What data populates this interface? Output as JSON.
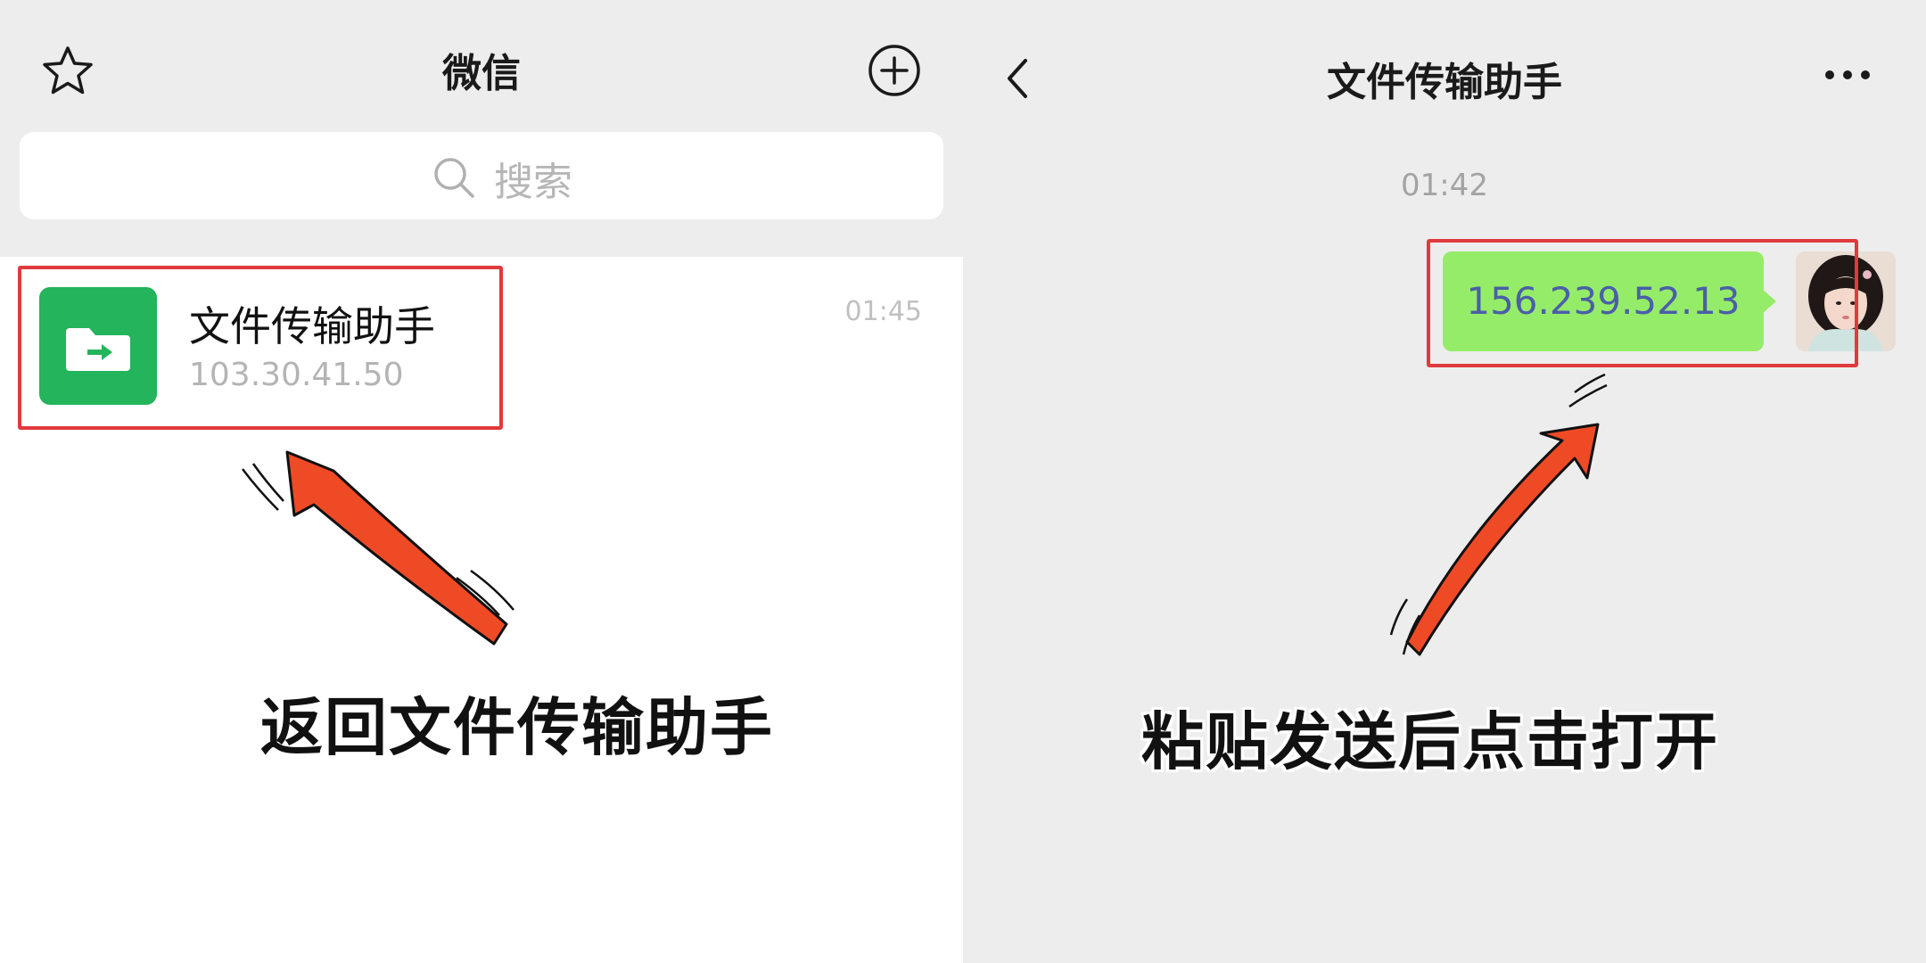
{
  "left": {
    "title": "微信",
    "search_placeholder": "搜索",
    "chat": {
      "name": "文件传输助手",
      "preview": "103.30.41.50",
      "time": "01:45"
    },
    "caption": "返回文件传输助手"
  },
  "right": {
    "title": "文件传输助手",
    "time_label": "01:42",
    "message": "156.239.52.13",
    "caption": "粘贴发送后点击打开"
  },
  "icons": {
    "star": "star-icon",
    "plus": "plus-circle-icon",
    "search": "search-icon",
    "folder": "folder-transfer-icon",
    "back": "chevron-left-icon",
    "more": "more-dots-icon"
  },
  "colors": {
    "wechat_green": "#23b45c",
    "bubble_green": "#95ec69",
    "highlight_red": "#e03a3e",
    "arrow_orange": "#ef4a26"
  }
}
